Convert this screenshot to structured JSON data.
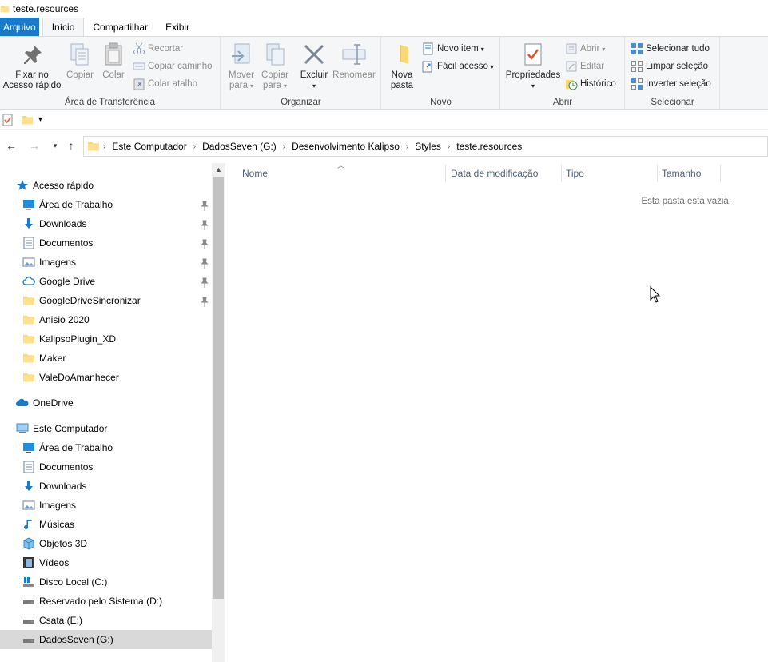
{
  "window": {
    "title": "teste.resources"
  },
  "ribbon_tabs": [
    "Arquivo",
    "Início",
    "Compartilhar",
    "Exibir"
  ],
  "ribbon": {
    "clipboard": {
      "label": "Área de Transferência",
      "pin_line1": "Fixar no",
      "pin_line2": "Acesso rápido",
      "copy": "Copiar",
      "paste": "Colar",
      "cut": "Recortar",
      "copy_path": "Copiar caminho",
      "paste_shortcut": "Colar atalho"
    },
    "organize": {
      "label": "Organizar",
      "move_line1": "Mover",
      "move_line2": "para",
      "copy_line1": "Copiar",
      "copy_line2": "para",
      "delete": "Excluir",
      "rename": "Renomear"
    },
    "new": {
      "label": "Novo",
      "new_folder_line1": "Nova",
      "new_folder_line2": "pasta",
      "new_item": "Novo item",
      "easy_access": "Fácil acesso"
    },
    "open": {
      "label": "Abrir",
      "properties": "Propriedades",
      "open": "Abrir",
      "edit": "Editar",
      "history": "Histórico"
    },
    "select": {
      "label": "Selecionar",
      "select_all": "Selecionar tudo",
      "select_none": "Limpar seleção",
      "invert": "Inverter seleção"
    }
  },
  "breadcrumb": [
    "Este Computador",
    "DadosSeven (G:)",
    "Desenvolvimento Kalipso",
    "Styles",
    "teste.resources"
  ],
  "nav": {
    "quick_access": "Acesso rápido",
    "quick_items": [
      "Área de Trabalho",
      "Downloads",
      "Documentos",
      "Imagens",
      "Google Drive",
      "GoogleDriveSincronizar",
      "Anisio 2020",
      "KalipsoPlugin_XD",
      "Maker",
      "ValeDoAmanhecer"
    ],
    "onedrive": "OneDrive",
    "this_pc": "Este Computador",
    "pc_items": [
      "Área de Trabalho",
      "Documentos",
      "Downloads",
      "Imagens",
      "Músicas",
      "Objetos 3D",
      "Vídeos",
      "Disco Local (C:)",
      "Reservado pelo Sistema (D:)",
      "Csata (E:)",
      "DadosSeven (G:)"
    ]
  },
  "columns": [
    "Nome",
    "Data de modificação",
    "Tipo",
    "Tamanho"
  ],
  "empty_message": "Esta pasta está vazia.",
  "colors": {
    "accent": "#1979ca",
    "folder": "#ffd766",
    "selected": "#d9d9d9"
  }
}
